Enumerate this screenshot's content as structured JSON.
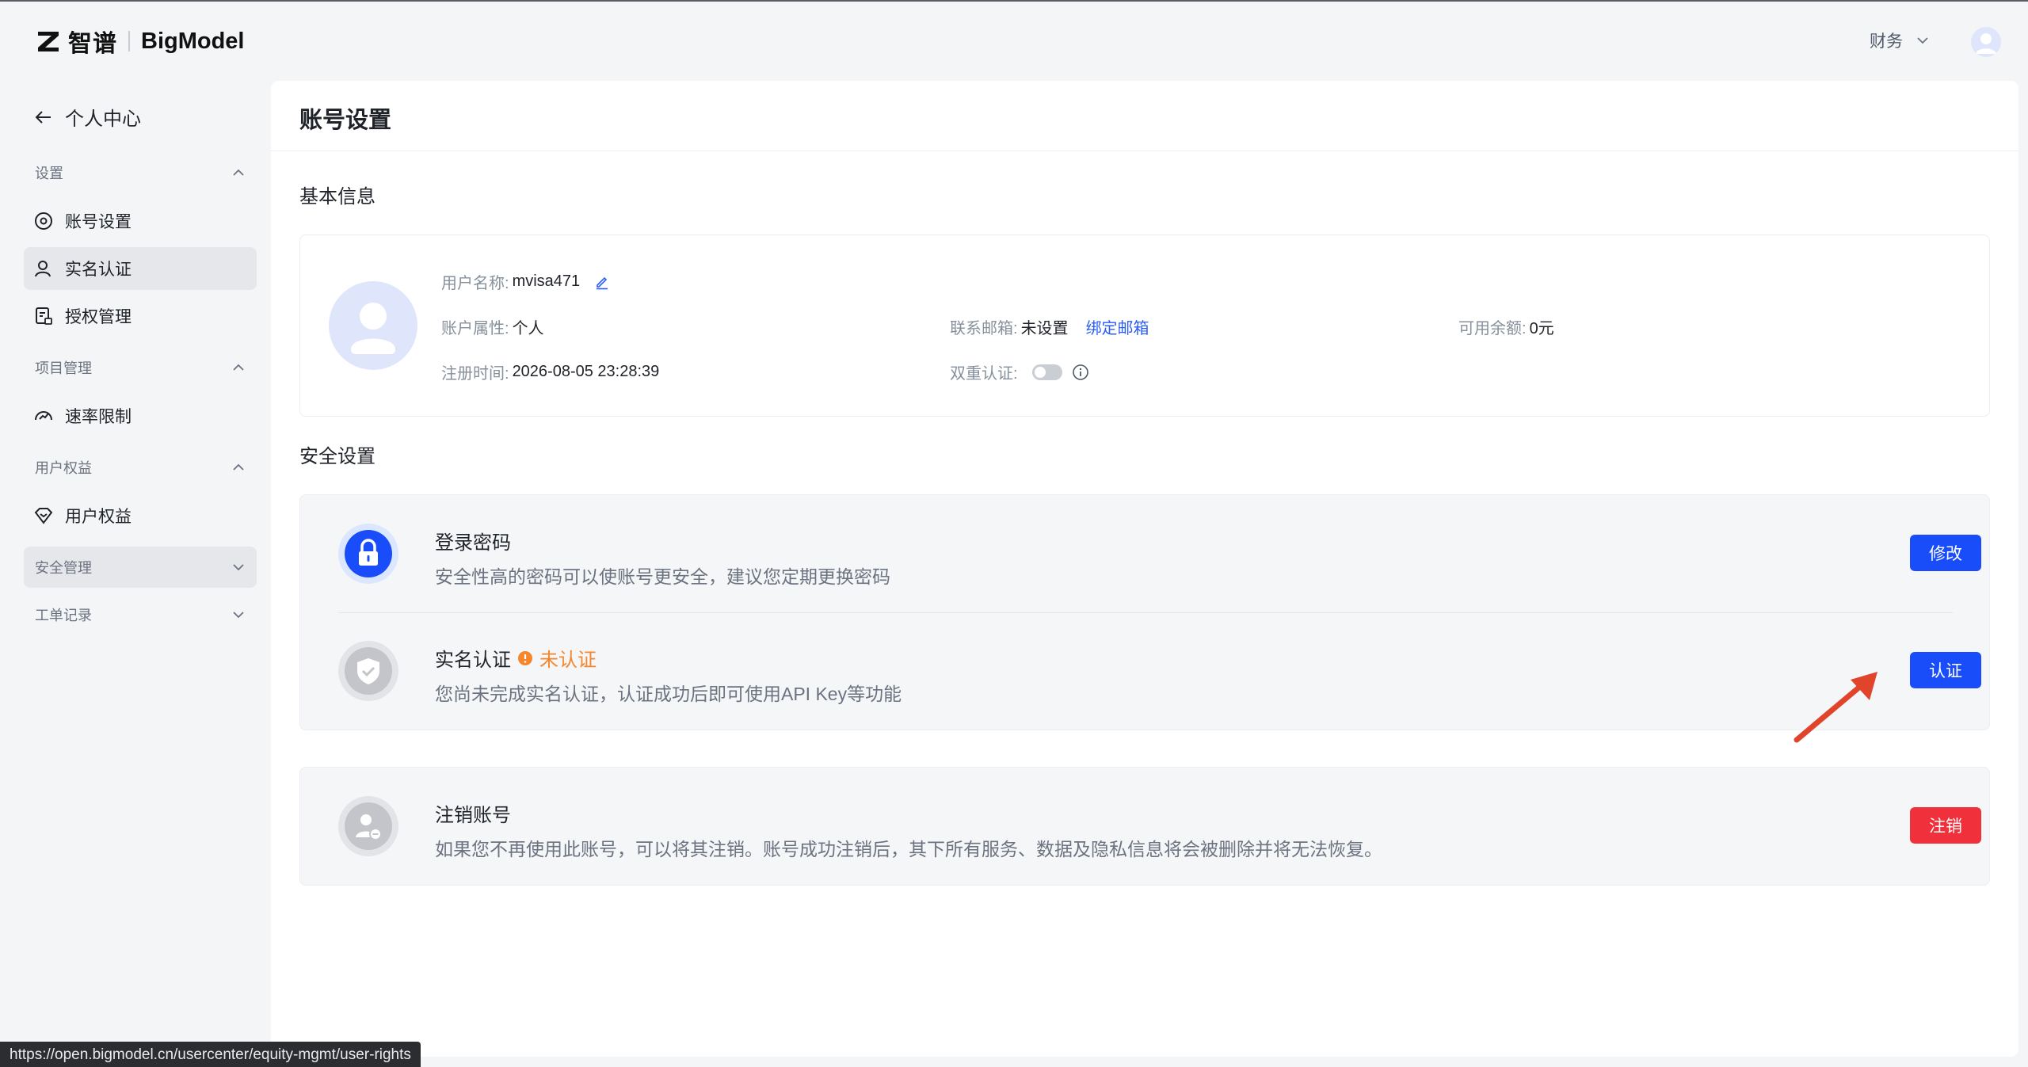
{
  "brand": {
    "name_cn": "智谱",
    "name_en": "BigModel"
  },
  "header": {
    "account_menu": "财务"
  },
  "sidebar": {
    "back_label": "个人中心",
    "sections": [
      {
        "title": "设置",
        "items": [
          "账号设置",
          "实名认证",
          "授权管理"
        ]
      },
      {
        "title": "项目管理",
        "items": [
          "速率限制"
        ]
      },
      {
        "title": "用户权益",
        "items": [
          "用户权益"
        ]
      },
      {
        "title": "安全管理"
      },
      {
        "title": "工单记录"
      }
    ]
  },
  "main": {
    "title": "账号设置",
    "basic_info": {
      "title": "基本信息",
      "username_label": "用户名称:",
      "username": "mvisa471",
      "account_type_label": "账户属性:",
      "account_type": "个人",
      "register_label": "注册时间:",
      "register_time": "2026-08-05 23:28:39",
      "email_label": "联系邮箱:",
      "email_value": "未设置",
      "email_link": "绑定邮箱",
      "twofa_label": "双重认证:",
      "balance_label": "可用余额:",
      "balance": "0元"
    },
    "security": {
      "title": "安全设置",
      "password": {
        "title": "登录密码",
        "desc": "安全性高的密码可以使账号更安全，建议您定期更换密码",
        "button": "修改"
      },
      "realname": {
        "title": "实名认证",
        "status": "未认证",
        "desc": "您尚未完成实名认证，认证成功后即可使用API Key等功能",
        "button": "认证"
      }
    },
    "cancel_account": {
      "title": "注销账号",
      "desc": "如果您不再使用此账号，可以将其注销。账号成功注销后，其下所有服务、数据及隐私信息将会被删除并将无法恢复。",
      "button": "注销"
    }
  },
  "status_bar": {
    "url": "https://open.bigmodel.cn/usercenter/equity-mgmt/user-rights"
  },
  "colors": {
    "primary": "#1a4dfa",
    "danger": "#f0303a",
    "warning": "#f5862b",
    "annotation_arrow": "#e0452c"
  }
}
